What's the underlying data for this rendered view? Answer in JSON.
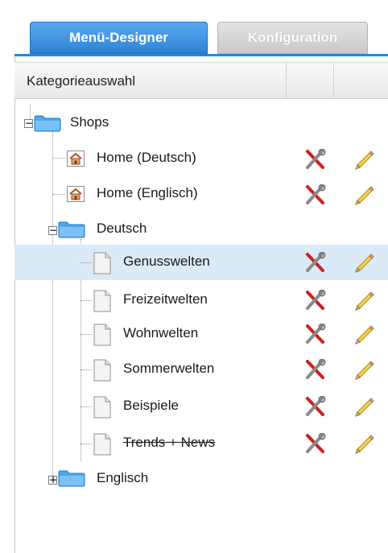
{
  "tabs": {
    "active": "Menü-Designer",
    "inactive": "Konfiguration"
  },
  "header": {
    "column_label": "Kategorieauswahl"
  },
  "tree": {
    "root": "Shops",
    "home_de": "Home (Deutsch)",
    "home_en": "Home (Englisch)",
    "deutsch": "Deutsch",
    "items": [
      "Genusswelten",
      "Freizeitwelten",
      "Wohnwelten",
      "Sommerwelten",
      "Beispiele",
      "Trends + News"
    ],
    "englisch": "Englisch",
    "toggle_expanded": "−",
    "toggle_collapsed": "+"
  },
  "icons": {
    "folder": "folder-icon",
    "page": "page-icon",
    "home": "home-icon",
    "settings": "tools-icon",
    "edit": "pencil-icon"
  },
  "colors": {
    "tab_active": "#2d82d6",
    "selection": "#dbeaf7",
    "folder_blue": "#3a9ae8"
  }
}
